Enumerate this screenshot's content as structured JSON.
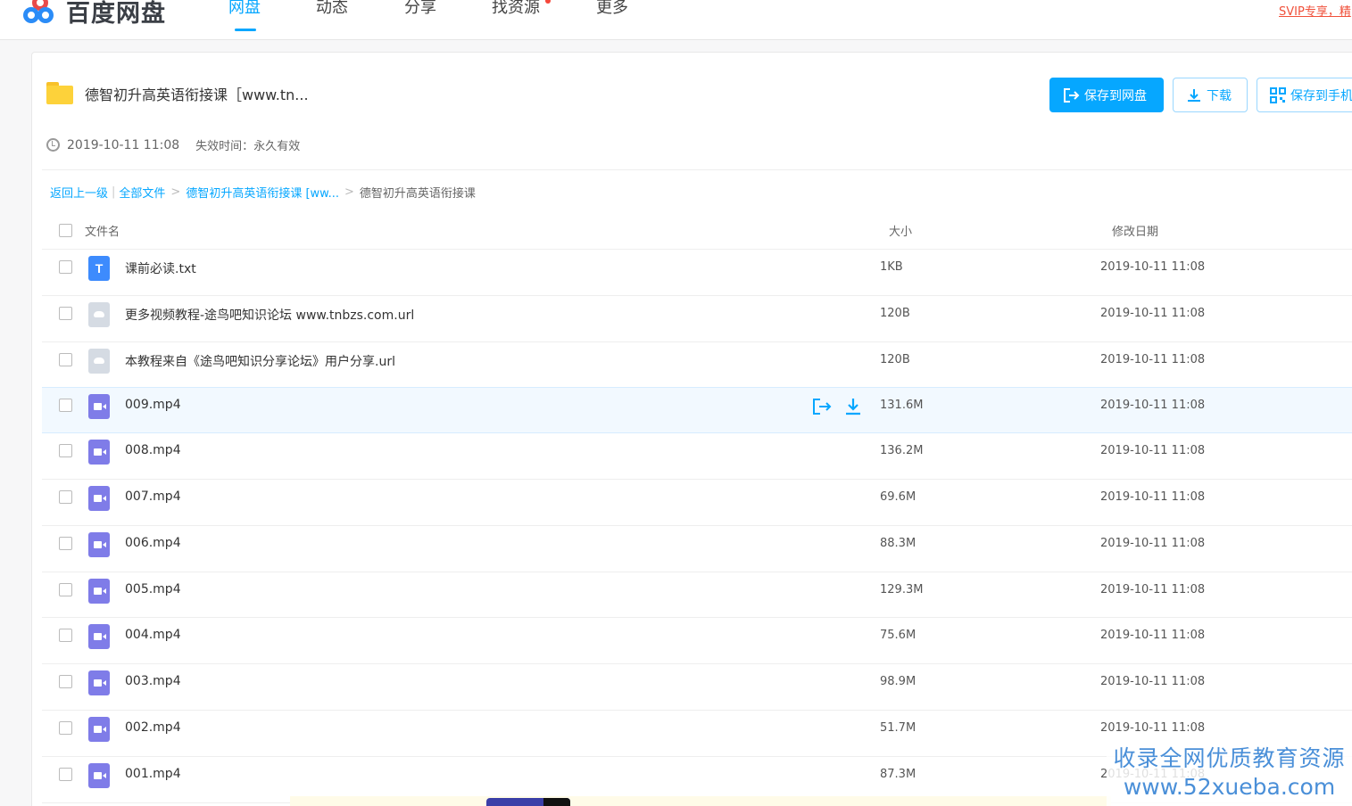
{
  "brand": {
    "name": "百度网盘"
  },
  "nav": [
    {
      "label": "网盘",
      "active": true,
      "dot": false
    },
    {
      "label": "动态",
      "active": false,
      "dot": false
    },
    {
      "label": "分享",
      "active": false,
      "dot": false
    },
    {
      "label": "找资源",
      "active": false,
      "dot": true
    },
    {
      "label": "更多",
      "active": false,
      "dot": false
    }
  ],
  "svip_banner": "SVIP专享，精",
  "share": {
    "title": "德智初升高英语衔接课［www.tn...",
    "date": "2019-10-11 11:08",
    "expire_label": "失效时间：",
    "expire_value": "永久有效"
  },
  "actions": {
    "save_label": "保存到网盘",
    "download_label": "下载",
    "save_phone_label": "保存到手机"
  },
  "breadcrumb": {
    "back": "返回上一级",
    "all_files": "全部文件",
    "level1": "德智初升高英语衔接课 [ww...",
    "current": "德智初升高英语衔接课"
  },
  "table": {
    "headers": {
      "name": "文件名",
      "size": "大小",
      "date": "修改日期"
    },
    "rows": [
      {
        "name": "课前必读.txt",
        "size": "1KB",
        "date": "2019-10-11 11:08",
        "type": "txt"
      },
      {
        "name": "更多视频教程-途鸟吧知识论坛 www.tnbzs.com.url",
        "size": "120B",
        "date": "2019-10-11 11:08",
        "type": "url"
      },
      {
        "name": "本教程来自《途鸟吧知识分享论坛》用户分享.url",
        "size": "120B",
        "date": "2019-10-11 11:08",
        "type": "url"
      },
      {
        "name": "009.mp4",
        "size": "131.6M",
        "date": "2019-10-11 11:08",
        "type": "video",
        "hover": true
      },
      {
        "name": "008.mp4",
        "size": "136.2M",
        "date": "2019-10-11 11:08",
        "type": "video"
      },
      {
        "name": "007.mp4",
        "size": "69.6M",
        "date": "2019-10-11 11:08",
        "type": "video"
      },
      {
        "name": "006.mp4",
        "size": "88.3M",
        "date": "2019-10-11 11:08",
        "type": "video"
      },
      {
        "name": "005.mp4",
        "size": "129.3M",
        "date": "2019-10-11 11:08",
        "type": "video"
      },
      {
        "name": "004.mp4",
        "size": "75.6M",
        "date": "2019-10-11 11:08",
        "type": "video"
      },
      {
        "name": "003.mp4",
        "size": "98.9M",
        "date": "2019-10-11 11:08",
        "type": "video"
      },
      {
        "name": "002.mp4",
        "size": "51.7M",
        "date": "2019-10-11 11:08",
        "type": "video"
      },
      {
        "name": "001.mp4",
        "size": "87.3M",
        "date": "2019-10-11 11:08",
        "type": "video"
      }
    ]
  },
  "watermark": {
    "line1": "收录全网优质教育资源",
    "line2": "www.52xueba.com"
  },
  "colors": {
    "accent": "#06a7ff",
    "video_icon": "#7f7ce8",
    "txt_icon": "#3d8bfd",
    "folder": "#fdd23a"
  }
}
